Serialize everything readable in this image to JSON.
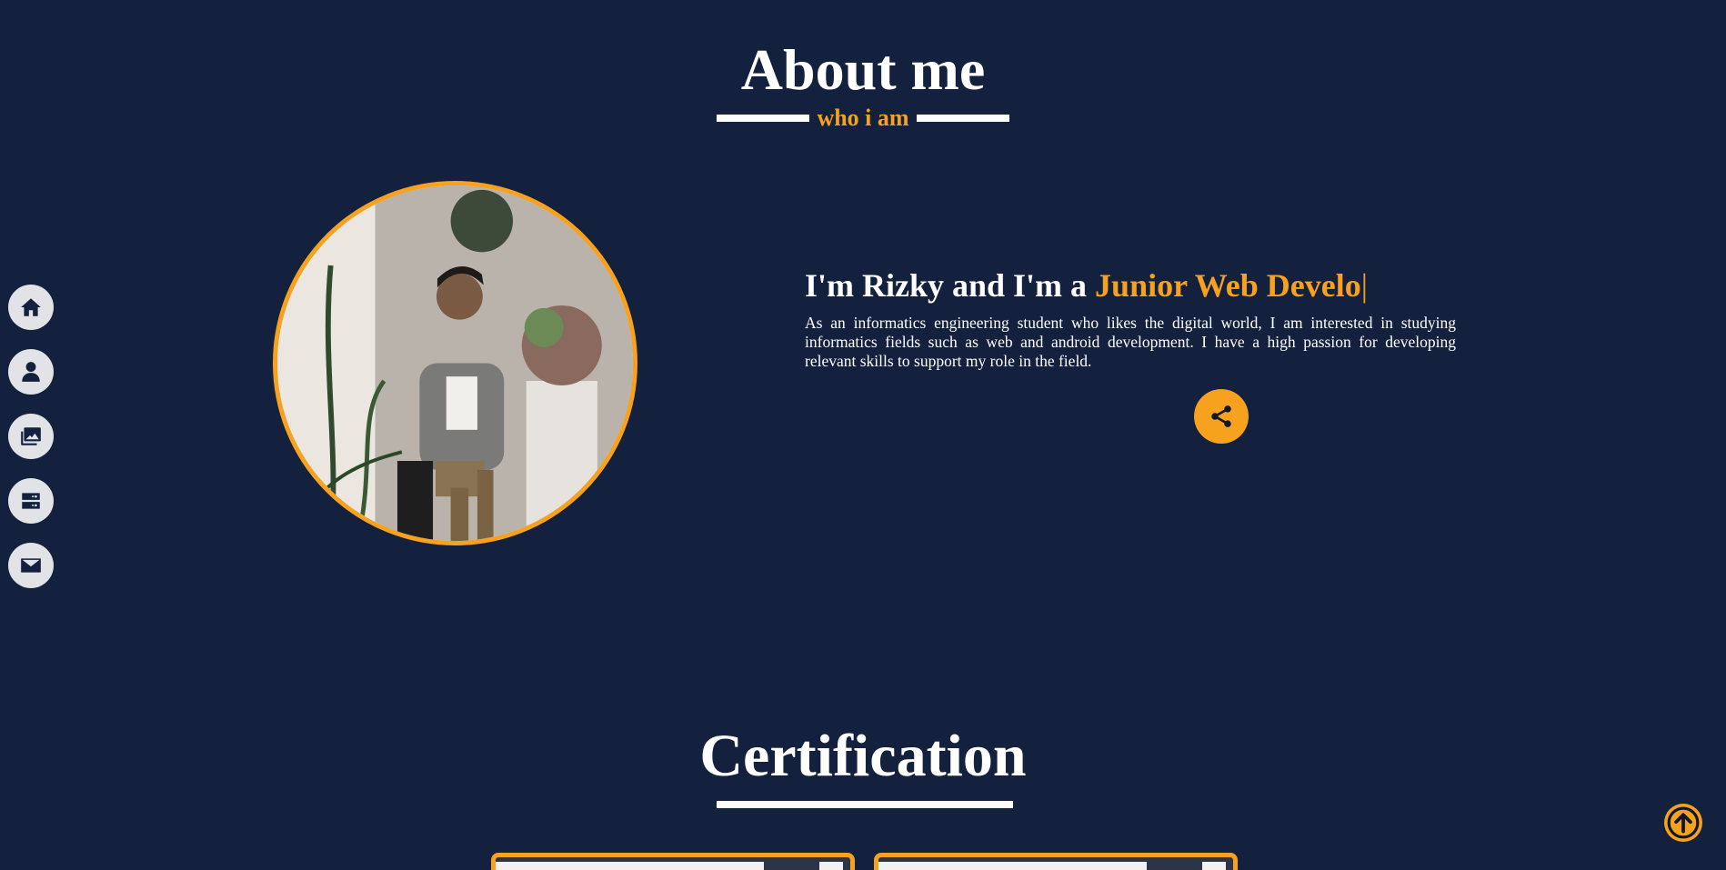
{
  "about": {
    "title": "About me",
    "subtitle": "who i am",
    "intro_prefix": "I'm Rizky and I'm a ",
    "intro_role": "Junior Web Develo",
    "intro_cursor": "|",
    "description": "As an informatics engineering student who likes the digital world, I am interested in studying informatics fields such as web and android development. I have a high passion for developing relevant skills to support my role in the field."
  },
  "certification": {
    "title": "Certification"
  },
  "sidebar": {
    "items": [
      {
        "icon": "home-icon"
      },
      {
        "icon": "user-icon"
      },
      {
        "icon": "gallery-icon"
      },
      {
        "icon": "server-icon"
      },
      {
        "icon": "envelope-icon"
      }
    ]
  },
  "colors": {
    "background": "#13203e",
    "accent": "#f6a21e",
    "text": "#ffffff",
    "nav_button": "#e2e3e6"
  }
}
